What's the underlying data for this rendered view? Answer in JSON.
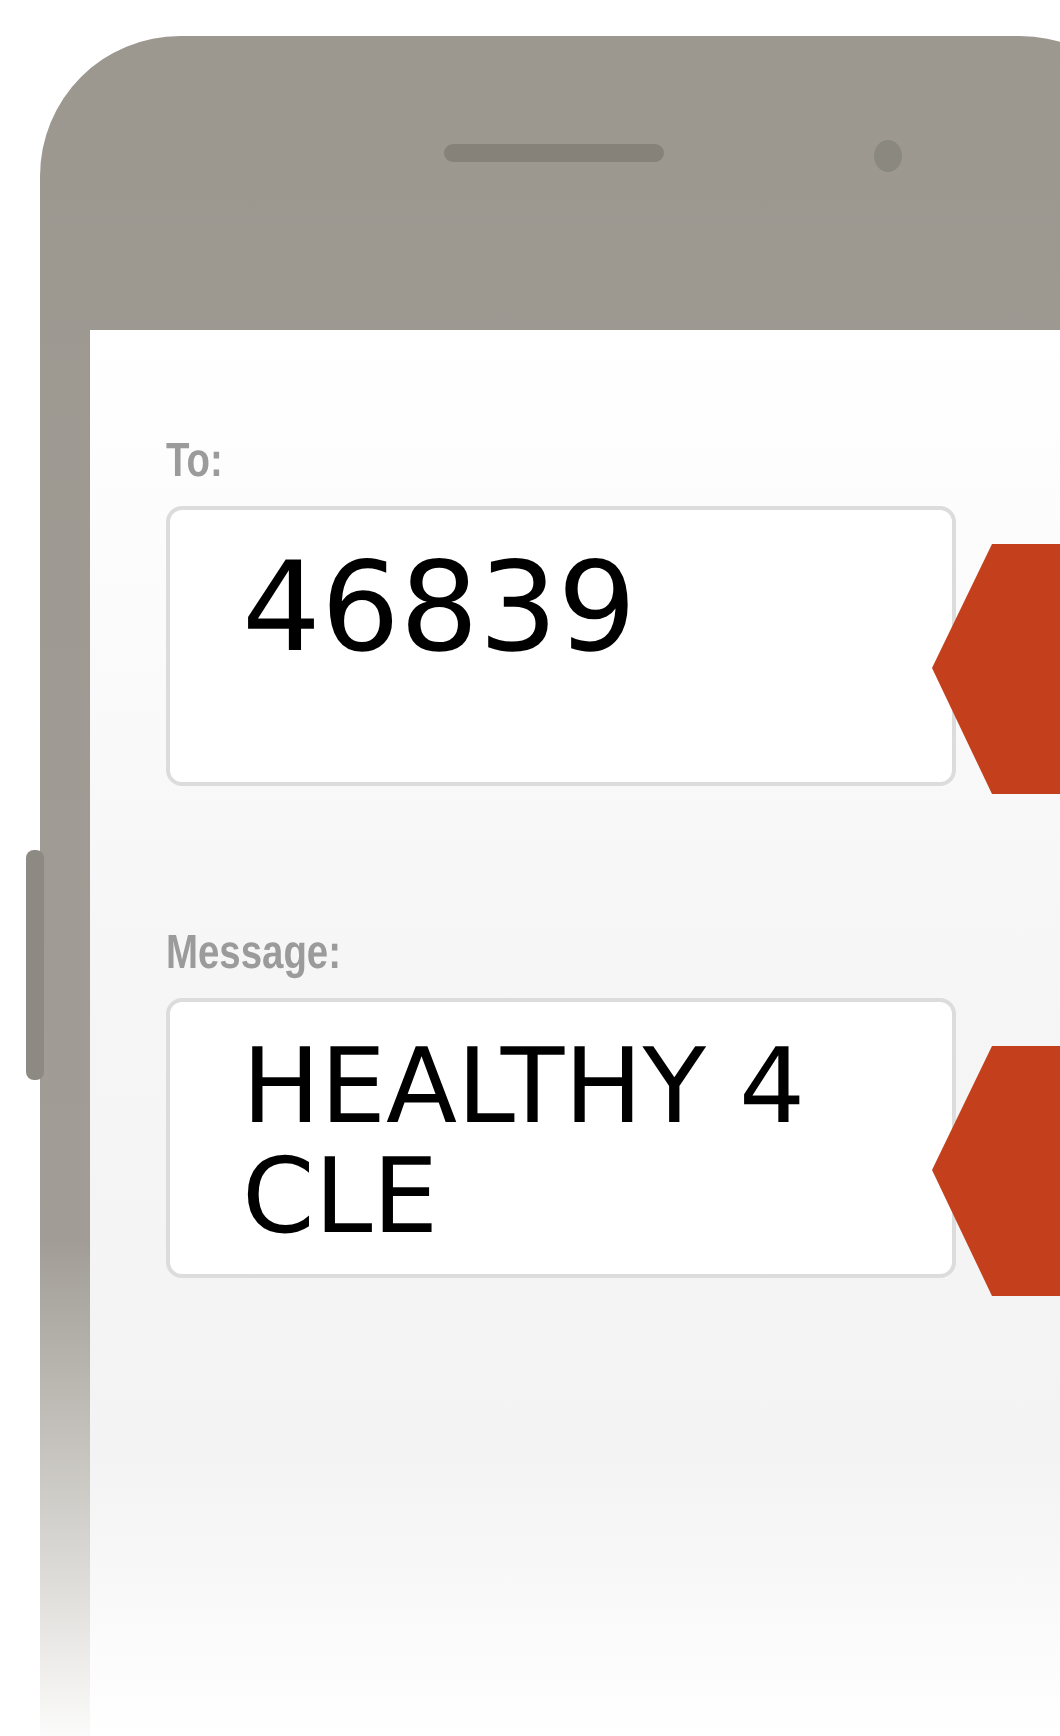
{
  "to": {
    "label": "To:",
    "value": "46839"
  },
  "message": {
    "label": "Message:",
    "value": "HEALTHY 4CLE"
  }
}
